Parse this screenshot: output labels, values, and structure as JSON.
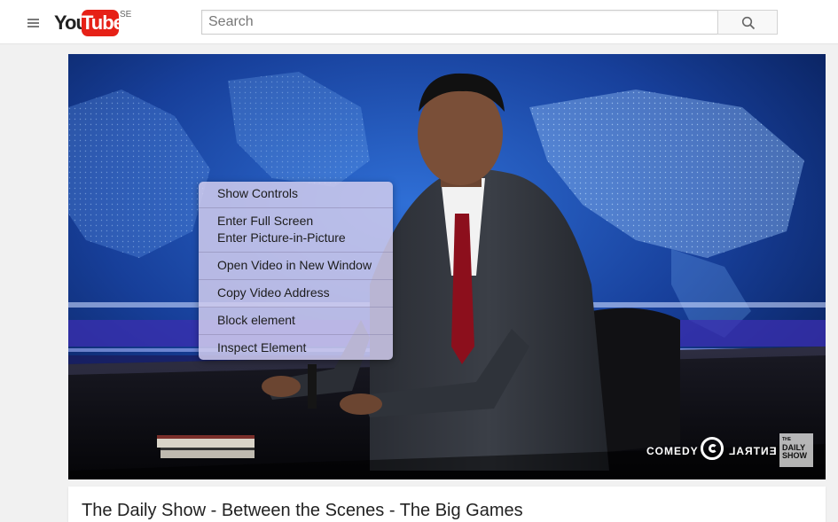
{
  "header": {
    "logo_you": "You",
    "logo_tube": "Tube",
    "logo_country": "SE",
    "search_placeholder": "Search"
  },
  "player": {
    "channel_logo_left": "COMEDY",
    "channel_logo_right": "ENTRAL",
    "show_logo": [
      "THE",
      "DAILY",
      "SHOW"
    ]
  },
  "context_menu": {
    "items": [
      "Show Controls",
      "Enter Full Screen",
      "Enter Picture-in-Picture",
      "Open Video in New Window",
      "Copy Video Address",
      "Block element",
      "Inspect Element"
    ]
  },
  "video": {
    "title": "The Daily Show - Between the Scenes - The Big Games"
  },
  "colors": {
    "brand_red": "#e62117",
    "menu_bg": "#d0ccee",
    "page_bg": "#f1f1f1"
  }
}
